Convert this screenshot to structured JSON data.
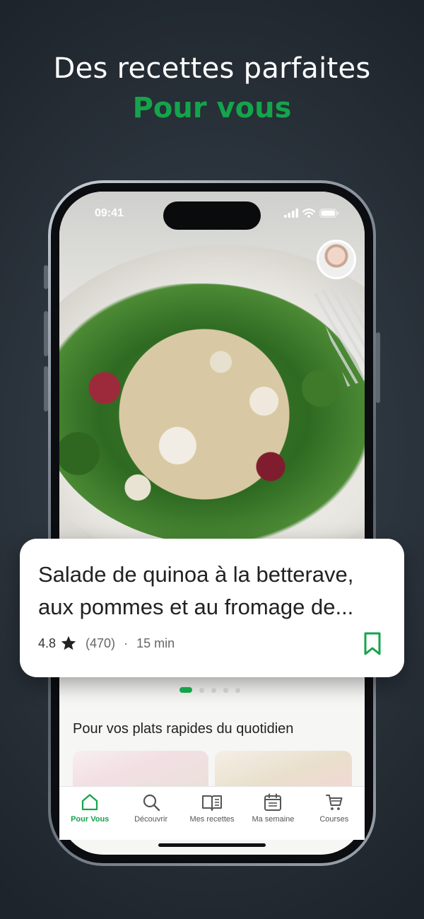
{
  "headline": {
    "line1": "Des recettes parfaites",
    "line2": "Pour vous"
  },
  "status_bar": {
    "time": "09:41"
  },
  "recipe_card": {
    "title": "Salade de quinoa à la betterave, aux pommes et au fromage de...",
    "rating": "4.8",
    "review_count": "(470)",
    "separator": "·",
    "duration": "15 min"
  },
  "carousel": {
    "page_count": 5,
    "active_index": 0
  },
  "section": {
    "title": "Pour vos plats rapides du quotidien"
  },
  "tabbar": {
    "items": [
      {
        "label": "Pour Vous",
        "icon": "home-icon",
        "active": true
      },
      {
        "label": "Découvrir",
        "icon": "search-icon",
        "active": false
      },
      {
        "label": "Mes recettes",
        "icon": "book-icon",
        "active": false
      },
      {
        "label": "Ma semaine",
        "icon": "calendar-icon",
        "active": false
      },
      {
        "label": "Courses",
        "icon": "cart-icon",
        "active": false
      }
    ]
  },
  "colors": {
    "accent": "#14a44b",
    "background": "#2a323b",
    "card": "#ffffff"
  }
}
